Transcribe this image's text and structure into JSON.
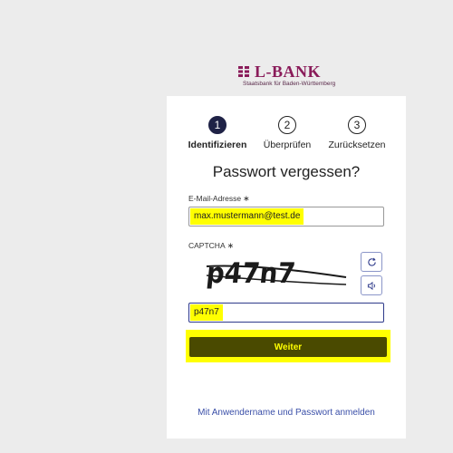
{
  "brand": {
    "name": "L-BANK",
    "subtitle": "Staatsbank für Baden-Württemberg",
    "color": "#8a1c5a"
  },
  "steps": [
    {
      "number": "1",
      "label": "Identifizieren",
      "active": true
    },
    {
      "number": "2",
      "label": "Überprüfen",
      "active": false
    },
    {
      "number": "3",
      "label": "Zurücksetzen",
      "active": false
    }
  ],
  "form": {
    "title": "Passwort vergessen?",
    "email_label": "E-Mail-Adresse",
    "email_value": "max.mustermann@test.de",
    "required_marker": "∗",
    "captcha_label": "CAPTCHA",
    "captcha_text": "p47n7",
    "captcha_value": "p47n7",
    "refresh_icon": "refresh-icon",
    "audio_icon": "speaker-icon",
    "submit_label": "Weiter",
    "alt_login_link": "Mit Anwendername und Passwort anmelden"
  },
  "colors": {
    "highlight": "#ffff00",
    "submit_bg": "#4a4a00",
    "active_step": "#1f2246",
    "link": "#3a4fa8"
  }
}
